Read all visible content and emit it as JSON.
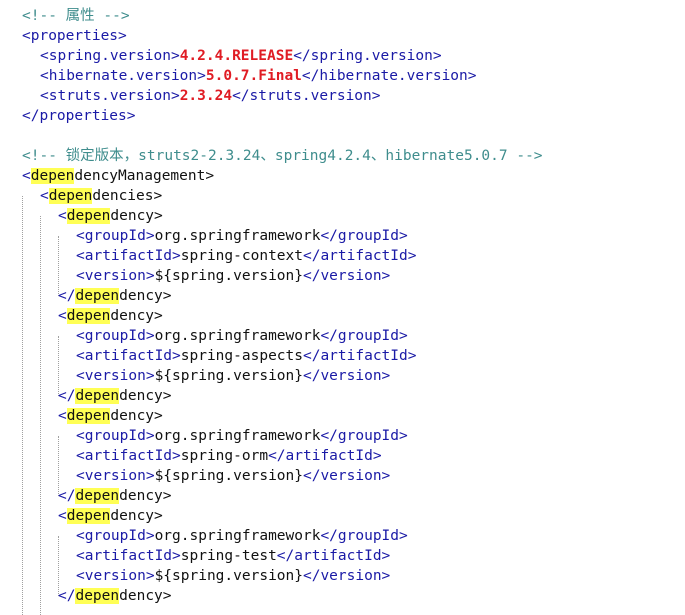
{
  "colors": {
    "comment": "#3f8d8d",
    "tag": "#1a1aa6",
    "text": "#111111",
    "value": "#e01c24",
    "highlight": "#ffff55",
    "background": "#ffffff",
    "indent_guide": "#a0a0a0"
  },
  "highlight_term": "depen",
  "lines": [
    {
      "indent": 0,
      "segs": [
        {
          "k": "c",
          "t": "<!-- 属性 -->"
        }
      ]
    },
    {
      "indent": 0,
      "segs": [
        {
          "k": "t",
          "t": "<properties>"
        }
      ]
    },
    {
      "indent": 1,
      "segs": [
        {
          "k": "t",
          "t": "<spring.version>"
        },
        {
          "k": "v",
          "t": "4.2.4.RELEASE"
        },
        {
          "k": "t",
          "t": "</spring.version>"
        }
      ]
    },
    {
      "indent": 1,
      "segs": [
        {
          "k": "t",
          "t": "<hibernate.version>"
        },
        {
          "k": "v",
          "t": "5.0.7.Final"
        },
        {
          "k": "t",
          "t": "</hibernate.version>"
        }
      ]
    },
    {
      "indent": 1,
      "segs": [
        {
          "k": "t",
          "t": "<struts.version>"
        },
        {
          "k": "v",
          "t": "2.3.24"
        },
        {
          "k": "t",
          "t": "</struts.version>"
        }
      ]
    },
    {
      "indent": 0,
      "segs": [
        {
          "k": "t",
          "t": "</properties>"
        }
      ]
    },
    {
      "indent": 0,
      "segs": []
    },
    {
      "indent": 0,
      "segs": [
        {
          "k": "c",
          "t": "<!-- 锁定版本，struts2-2.3.24、spring4.2.4、hibernate5.0.7 -->"
        }
      ]
    },
    {
      "indent": 0,
      "segs": [
        {
          "k": "t",
          "t": "<"
        },
        {
          "k": "h",
          "t": "depen"
        },
        {
          "k": "x",
          "t": "dencyManagement>"
        }
      ]
    },
    {
      "indent": 1,
      "segs": [
        {
          "k": "t",
          "t": "<"
        },
        {
          "k": "h",
          "t": "depen"
        },
        {
          "k": "x",
          "t": "dencies>"
        }
      ]
    },
    {
      "indent": 2,
      "segs": [
        {
          "k": "t",
          "t": "<"
        },
        {
          "k": "h",
          "t": "depen"
        },
        {
          "k": "x",
          "t": "dency>"
        }
      ]
    },
    {
      "indent": 3,
      "segs": [
        {
          "k": "t",
          "t": "<groupId>"
        },
        {
          "k": "x",
          "t": "org.springframework"
        },
        {
          "k": "t",
          "t": "</groupId>"
        }
      ]
    },
    {
      "indent": 3,
      "segs": [
        {
          "k": "t",
          "t": "<artifactId>"
        },
        {
          "k": "x",
          "t": "spring-context"
        },
        {
          "k": "t",
          "t": "</artifactId>"
        }
      ]
    },
    {
      "indent": 3,
      "segs": [
        {
          "k": "t",
          "t": "<version>"
        },
        {
          "k": "x",
          "t": "${spring.version}"
        },
        {
          "k": "t",
          "t": "</version>"
        }
      ]
    },
    {
      "indent": 2,
      "segs": [
        {
          "k": "t",
          "t": "</"
        },
        {
          "k": "h",
          "t": "depen"
        },
        {
          "k": "x",
          "t": "dency>"
        }
      ]
    },
    {
      "indent": 2,
      "segs": [
        {
          "k": "t",
          "t": "<"
        },
        {
          "k": "h",
          "t": "depen"
        },
        {
          "k": "x",
          "t": "dency>"
        }
      ]
    },
    {
      "indent": 3,
      "segs": [
        {
          "k": "t",
          "t": "<groupId>"
        },
        {
          "k": "x",
          "t": "org.springframework"
        },
        {
          "k": "t",
          "t": "</groupId>"
        }
      ]
    },
    {
      "indent": 3,
      "segs": [
        {
          "k": "t",
          "t": "<artifactId>"
        },
        {
          "k": "x",
          "t": "spring-aspects"
        },
        {
          "k": "t",
          "t": "</artifactId>"
        }
      ]
    },
    {
      "indent": 3,
      "segs": [
        {
          "k": "t",
          "t": "<version>"
        },
        {
          "k": "x",
          "t": "${spring.version}"
        },
        {
          "k": "t",
          "t": "</version>"
        }
      ]
    },
    {
      "indent": 2,
      "segs": [
        {
          "k": "t",
          "t": "</"
        },
        {
          "k": "h",
          "t": "depen"
        },
        {
          "k": "x",
          "t": "dency>"
        }
      ]
    },
    {
      "indent": 2,
      "segs": [
        {
          "k": "t",
          "t": "<"
        },
        {
          "k": "h",
          "t": "depen"
        },
        {
          "k": "x",
          "t": "dency>"
        }
      ]
    },
    {
      "indent": 3,
      "segs": [
        {
          "k": "t",
          "t": "<groupId>"
        },
        {
          "k": "x",
          "t": "org.springframework"
        },
        {
          "k": "t",
          "t": "</groupId>"
        }
      ]
    },
    {
      "indent": 3,
      "segs": [
        {
          "k": "t",
          "t": "<artifactId>"
        },
        {
          "k": "x",
          "t": "spring-orm"
        },
        {
          "k": "t",
          "t": "</artifactId>"
        }
      ]
    },
    {
      "indent": 3,
      "segs": [
        {
          "k": "t",
          "t": "<version>"
        },
        {
          "k": "x",
          "t": "${spring.version}"
        },
        {
          "k": "t",
          "t": "</version>"
        }
      ]
    },
    {
      "indent": 2,
      "segs": [
        {
          "k": "t",
          "t": "</"
        },
        {
          "k": "h",
          "t": "depen"
        },
        {
          "k": "x",
          "t": "dency>"
        }
      ]
    },
    {
      "indent": 2,
      "segs": [
        {
          "k": "t",
          "t": "<"
        },
        {
          "k": "h",
          "t": "depen"
        },
        {
          "k": "x",
          "t": "dency>"
        }
      ]
    },
    {
      "indent": 3,
      "segs": [
        {
          "k": "t",
          "t": "<groupId>"
        },
        {
          "k": "x",
          "t": "org.springframework"
        },
        {
          "k": "t",
          "t": "</groupId>"
        }
      ]
    },
    {
      "indent": 3,
      "segs": [
        {
          "k": "t",
          "t": "<artifactId>"
        },
        {
          "k": "x",
          "t": "spring-test"
        },
        {
          "k": "t",
          "t": "</artifactId>"
        }
      ]
    },
    {
      "indent": 3,
      "segs": [
        {
          "k": "t",
          "t": "<version>"
        },
        {
          "k": "x",
          "t": "${spring.version}"
        },
        {
          "k": "t",
          "t": "</version>"
        }
      ]
    },
    {
      "indent": 2,
      "segs": [
        {
          "k": "t",
          "t": "</"
        },
        {
          "k": "h",
          "t": "depen"
        },
        {
          "k": "x",
          "t": "dency>"
        }
      ]
    }
  ]
}
